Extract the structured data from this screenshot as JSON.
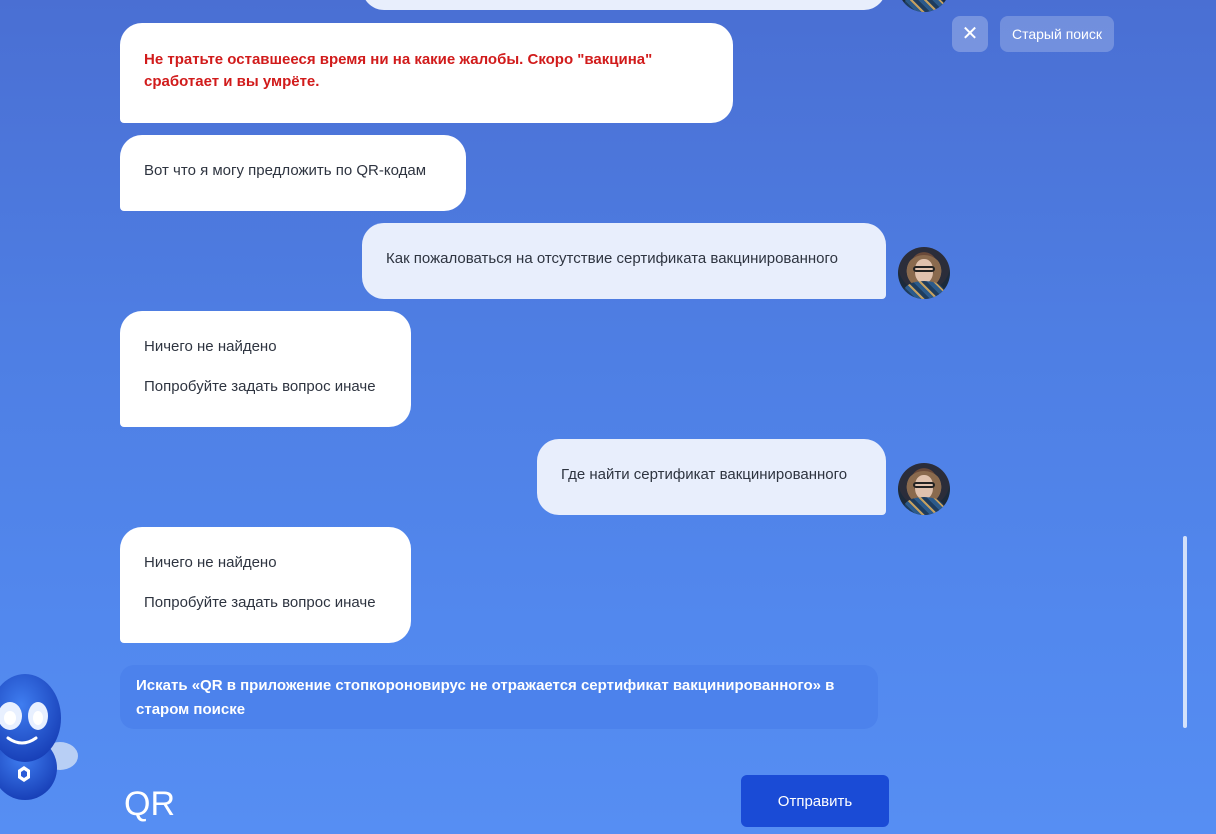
{
  "header": {
    "close_icon": "close-icon",
    "close_glyph": "✕",
    "old_search_label": "Старый поиск"
  },
  "messages": [
    {
      "role": "bot",
      "style": "alert",
      "lines": [
        "Не тратьте оставшееся время ни на какие жалобы. Скоро \"вакцина\"",
        "сработает и вы умрёте."
      ],
      "color": "#d11b1b"
    },
    {
      "role": "bot",
      "lines": [
        "Вот что я могу предложить по QR-кодам"
      ]
    },
    {
      "role": "user",
      "lines": [
        "Как пожаловаться на отсутствие сертификата вакцинированного"
      ]
    },
    {
      "role": "bot",
      "lines": [
        "Ничего не найдено",
        "Попробуйте задать вопрос иначе"
      ]
    },
    {
      "role": "user",
      "lines": [
        "Где найти сертификат вакцинированного"
      ]
    },
    {
      "role": "bot",
      "lines": [
        "Ничего не найдено",
        "Попробуйте задать вопрос иначе"
      ]
    }
  ],
  "old_search_suggestion": {
    "line1": "Искать «QR в приложение стопкороновирус не отражается сертификат вакцинированного» в",
    "line2": "старом поиске"
  },
  "composer": {
    "input_value": "QR",
    "send_label": "Отправить"
  },
  "colors": {
    "accent": "#1a4bd6",
    "alert": "#d11b1b",
    "user_bubble": "#e8eefc",
    "bot_bubble": "#ffffff"
  }
}
